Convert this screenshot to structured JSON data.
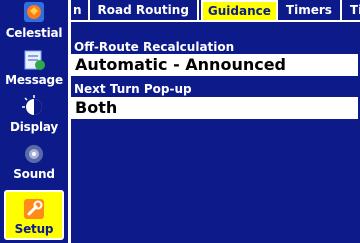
{
  "sidebar": {
    "items": [
      {
        "label": "Celestial",
        "icon": "celestial-icon",
        "active": false
      },
      {
        "label": "Message",
        "icon": "message-icon",
        "active": false
      },
      {
        "label": "Display",
        "icon": "display-icon",
        "active": false
      },
      {
        "label": "Sound",
        "icon": "sound-icon",
        "active": false
      },
      {
        "label": "Setup",
        "icon": "setup-wrench-icon",
        "active": true
      }
    ]
  },
  "tabs": [
    {
      "label": "n",
      "partial": true
    },
    {
      "label": "Road Routing"
    },
    {
      "label": "Guidance",
      "selected": true
    },
    {
      "label": "Timers"
    },
    {
      "label": "Time"
    }
  ],
  "settings": {
    "off_route": {
      "label": "Off-Route Recalculation",
      "value": "Automatic - Announced"
    },
    "next_turn": {
      "label": "Next Turn Pop-up",
      "value": "Both"
    }
  },
  "colors": {
    "background": "#0c1a8a",
    "highlight": "#ffff00",
    "field": "#ffffff",
    "text": "#ffffff"
  }
}
